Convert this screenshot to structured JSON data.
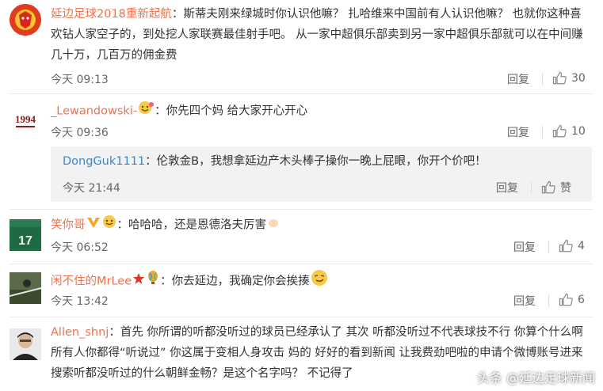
{
  "comments": [
    {
      "username": "延边足球2018重新起航",
      "text": "：斯蒂夫刚来绿城时你认识他嘛？ 扎哈维来中国前有人认识他嘛？ 也就你这种喜欢钻人家空子的，到处挖人家联赛最佳射手吧。 从一家中超俱乐部卖到另一家中超俱乐部就可以在中间赚几十万，几百万的佣金费",
      "time": "今天 09:13",
      "reply_label": "回复",
      "likes": "30"
    },
    {
      "username": "_Lewandowski-",
      "text": "：你先四个妈 给大家开心开心",
      "time": "今天 09:36",
      "reply_label": "回复",
      "likes": "10",
      "avatar_text": "1994"
    },
    {
      "username": "笑你哥",
      "text": "：哈哈哈，还是恩德洛夫厉害",
      "time": "今天 06:52",
      "reply_label": "回复",
      "likes": "4",
      "avatar_text": "17"
    },
    {
      "username": "闲不住的MrLee",
      "text": "：你去延边，我确定你会挨揍",
      "time": "今天 13:42",
      "reply_label": "回复",
      "likes": "6"
    },
    {
      "username": "Allen_shnj",
      "text": "：首先 你所谓的听都没听过的球员已经承认了 其次 听都没听过不代表球技不行 你算个什么啊 所有人你都得“听说过” 你这属于变相人身攻击 妈的 好好的看到新闻 让我费劲吧啦的申请个微博账号进来搜索听都没听过的什么朝鲜金畅？是这个名字吗？ 不记得了"
    }
  ],
  "nested_reply": {
    "username": "DongGuk1111",
    "text": "：伦敦金B，我想拿延边产木头棒子操你一晚上屁眼，你开个价吧！",
    "time": "今天 21:44",
    "reply_label": "回复",
    "like_label": "赞"
  },
  "watermark": "头条 @延边足球新闻",
  "colors": {
    "username": "#eb7350",
    "nested_username": "#3c86c4",
    "nested_bg": "#f2f2f5"
  }
}
